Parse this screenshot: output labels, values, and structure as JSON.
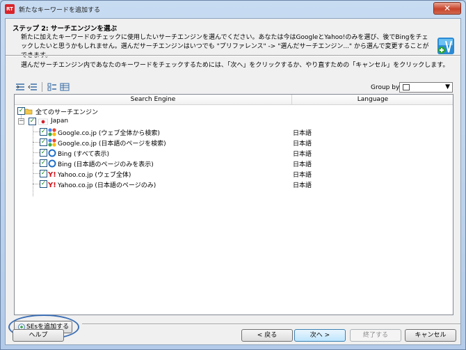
{
  "window": {
    "title": "新たなキーワードを追加する",
    "close_symbol": "✕"
  },
  "header": {
    "step_title": "ステップ 2: サーチエンジンを選ぶ",
    "description": "新たに加えたキーワードのチェックに使用したいサーチエンジンを選んでください。あなたは今はGoogleとYahoo!のみを選び、後でBingをチェックしたいと思うかもしれません。選んだサーチエンジンはいつでも \"プリファレンス\" -> \"選んだサーチエンジン...\" から選んで変更することができます。",
    "instruction": "選んだサーチエンジン内であなたのキーワードをチェックするためには、「次へ」をクリックするか、やり直すための「キャンセル」をクリックします。"
  },
  "toolbar": {
    "group_by_label": "Group by:"
  },
  "grid": {
    "columns": [
      "Search Engine",
      "Language"
    ],
    "root": {
      "label": "全てのサーチエンジン",
      "checked": true
    },
    "region": {
      "label": "Japan",
      "checked": true
    },
    "engines": [
      {
        "label": "Google.co.jp (ウェブ全体から検索)",
        "language": "日本語",
        "icon": "google-icon",
        "checked": true
      },
      {
        "label": "Google.co.jp (日本語のページを検索)",
        "language": "日本語",
        "icon": "google-icon",
        "checked": true
      },
      {
        "label": "Bing (すべて表示)",
        "language": "日本語",
        "icon": "bing-icon",
        "checked": true
      },
      {
        "label": "Bing (日本語のページのみを表示)",
        "language": "日本語",
        "icon": "bing-icon",
        "checked": true
      },
      {
        "label": "Yahoo.co.jp (ウェブ全体)",
        "language": "日本語",
        "icon": "yahoo-icon",
        "checked": true
      },
      {
        "label": "Yahoo.co.jp (日本語のページのみ)",
        "language": "日本語",
        "icon": "yahoo-icon",
        "checked": true
      }
    ]
  },
  "buttons": {
    "add_se": "SEsを追加する",
    "help": "ヘルプ",
    "back": "< 戻る",
    "next": "次へ >",
    "finish": "終了する",
    "cancel": "キャンセル"
  },
  "colors": {
    "accent": "#3c7fb1",
    "highlight_oval": "#3c6fb5",
    "check": "#1a8a1a"
  }
}
